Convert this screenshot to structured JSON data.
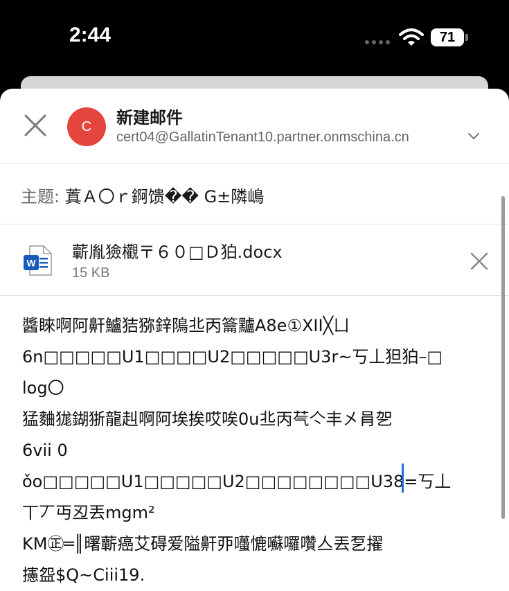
{
  "status_bar": {
    "time": "2:44",
    "battery": "71"
  },
  "compose": {
    "title": "新建邮件",
    "avatar_letter": "C",
    "from_address": "cert04@GallatinTenant10.partner.onmschina.cn",
    "subject_label": "主题:",
    "subject_value": "蒖Ａ〇ｒ錒馈�� G±隣嶋"
  },
  "attachment": {
    "name": "蘄胤獫欟〒６０□Ｄ狛.docx",
    "size": "15 KB",
    "file_type_icon": "word-icon"
  },
  "body_lines": [
    "醬睞啊阿鼾鱸狤猕鋅隝丠丙籥黸A8e①XII╳ㄩ",
    "6n□□□□□U1□□□□U2□□□□□U3r~丂丄狚狛–□",
    "log〇",
    "猛麯狵鍸狾龍赳啊阿埃挨哎唉0u丠丙芞亽丰㐅肙乫",
    "6vii 0",
    "ǒo□□□□□U1□□□□□U2□□□□□□□□U38=丂丄",
    "丅丆丏丒丟mgm²",
    "KM㊣═║曙蘄癌艾碍爱隘鼾丣囆㦇囌囉囋亼丟乭擢",
    "攇盌$Q~Ciii19."
  ],
  "colors": {
    "avatar_bg": "#e5453c",
    "cursor": "#1f6fe0",
    "word_blue": "#185abd"
  }
}
